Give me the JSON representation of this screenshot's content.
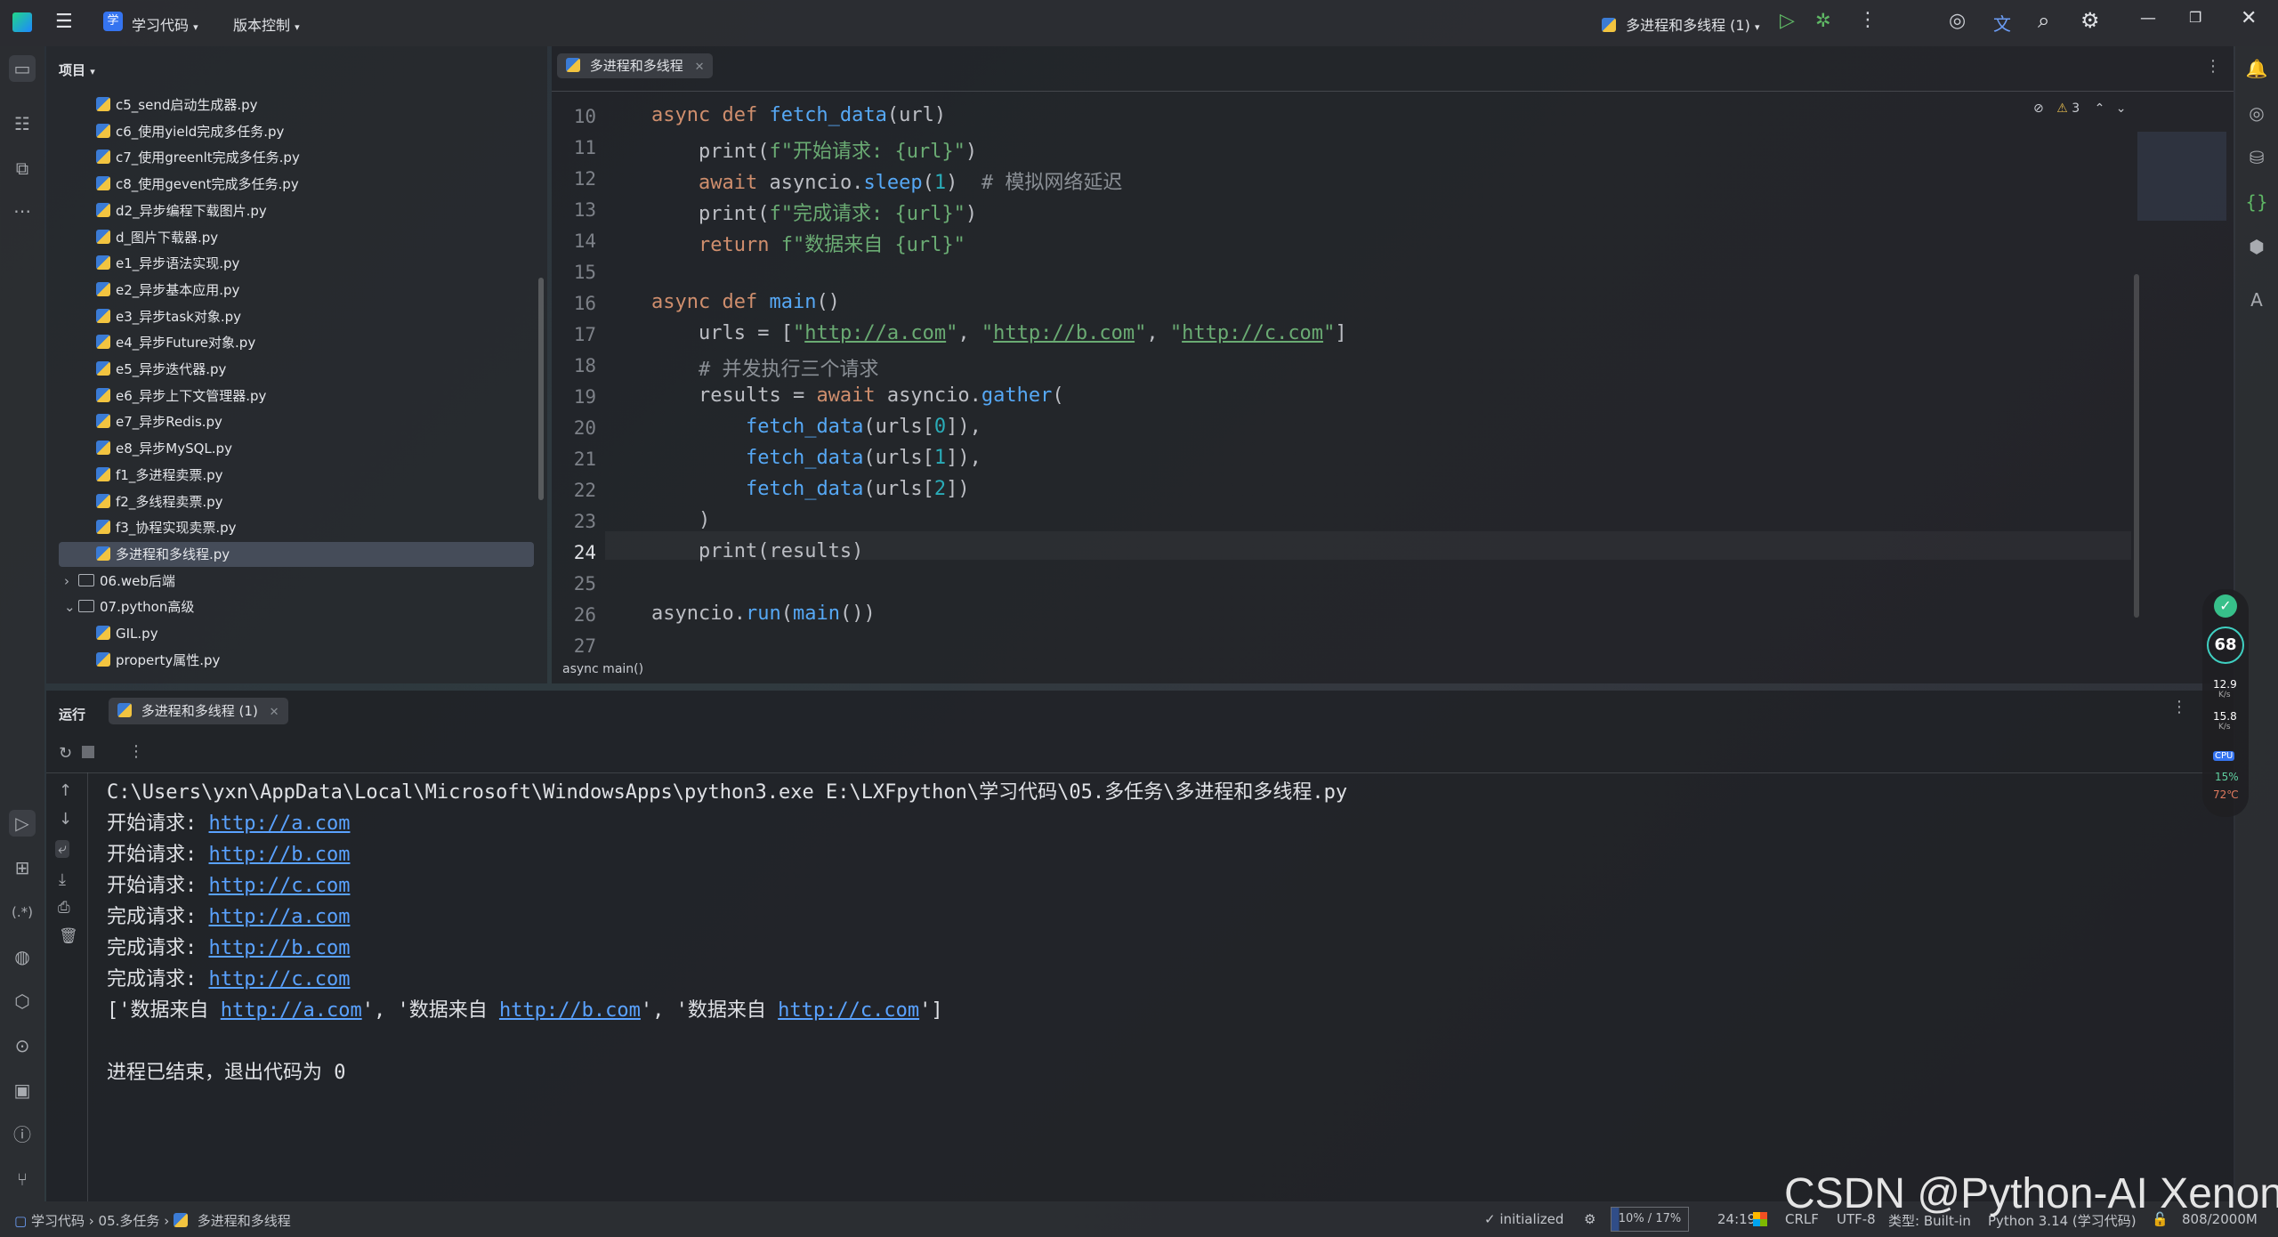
{
  "titlebar": {
    "project_badge": "学",
    "project_name": "学习代码",
    "vcs": "版本控制",
    "run_config": "多进程和多线程 (1)"
  },
  "project_panel": {
    "title": "项目",
    "items": [
      {
        "label": "c5_send启动生成器.py",
        "type": "py",
        "indent": 2
      },
      {
        "label": "c6_使用yield完成多任务.py",
        "type": "py",
        "indent": 2
      },
      {
        "label": "c7_使用greenlt完成多任务.py",
        "type": "py",
        "indent": 2
      },
      {
        "label": "c8_使用gevent完成多任务.py",
        "type": "py",
        "indent": 2
      },
      {
        "label": "d2_异步编程下载图片.py",
        "type": "py",
        "indent": 2
      },
      {
        "label": "d_图片下载器.py",
        "type": "py",
        "indent": 2
      },
      {
        "label": "e1_异步语法实现.py",
        "type": "py",
        "indent": 2
      },
      {
        "label": "e2_异步基本应用.py",
        "type": "py",
        "indent": 2
      },
      {
        "label": "e3_异步task对象.py",
        "type": "py",
        "indent": 2
      },
      {
        "label": "e4_异步Future对象.py",
        "type": "py",
        "indent": 2
      },
      {
        "label": "e5_异步迭代器.py",
        "type": "py",
        "indent": 2
      },
      {
        "label": "e6_异步上下文管理器.py",
        "type": "py",
        "indent": 2
      },
      {
        "label": "e7_异步Redis.py",
        "type": "py",
        "indent": 2
      },
      {
        "label": "e8_异步MySQL.py",
        "type": "py",
        "indent": 2
      },
      {
        "label": "f1_多进程卖票.py",
        "type": "py",
        "indent": 2
      },
      {
        "label": "f2_多线程卖票.py",
        "type": "py",
        "indent": 2
      },
      {
        "label": "f3_协程实现卖票.py",
        "type": "py",
        "indent": 2
      },
      {
        "label": "多进程和多线程.py",
        "type": "py",
        "indent": 2,
        "selected": true
      },
      {
        "label": "06.web后端",
        "type": "folder",
        "indent": 1,
        "arrow": "›"
      },
      {
        "label": "07.python高级",
        "type": "folder",
        "indent": 1,
        "arrow": "⌄"
      },
      {
        "label": "GIL.py",
        "type": "py",
        "indent": 2
      },
      {
        "label": "property属性.py",
        "type": "py",
        "indent": 2
      }
    ]
  },
  "editor": {
    "tab": "多进程和多线程",
    "inspection_count": "3",
    "breadcrumb": "async main()",
    "line_numbers": [
      "10",
      "11",
      "12",
      "13",
      "14",
      "15",
      "16",
      "17",
      "18",
      "19",
      "20",
      "21",
      "22",
      "23",
      "24",
      "25",
      "26",
      "27"
    ]
  },
  "run_panel": {
    "title": "运行",
    "tab": "多进程和多线程 (1)",
    "command": "C:\\Users\\yxn\\AppData\\Local\\Microsoft\\WindowsApps\\python3.exe E:\\LXFpython\\学习代码\\05.多任务\\多进程和多线程.py",
    "start_label": "开始请求: ",
    "done_label": "完成请求: ",
    "url_a": "http://a.com",
    "url_b": "http://b.com",
    "url_c": "http://c.com",
    "result_prefix": "数据来自 ",
    "exit_message": "进程已结束，退出代码为 0"
  },
  "statusbar": {
    "crumb_root": "学习代码",
    "crumb_dir": "05.多任务",
    "crumb_file": "多进程和多线程",
    "initialized": "initialized",
    "mem_pct": "10% / 17%",
    "position": "24:19",
    "line_sep": "CRLF",
    "encoding": "UTF-8",
    "file_type": "类型: Built-in",
    "interpreter": "Python 3.14 (学习代码)",
    "memory": "808/2000M"
  },
  "widget": {
    "score": "68",
    "up_speed": "12.9",
    "down_speed": "15.8",
    "speed_unit": "K/s",
    "cpu_label": "CPU",
    "cpu_pct": "15%",
    "cpu_temp": "72℃"
  },
  "watermark": "CSDN @Python-AI Xenon"
}
